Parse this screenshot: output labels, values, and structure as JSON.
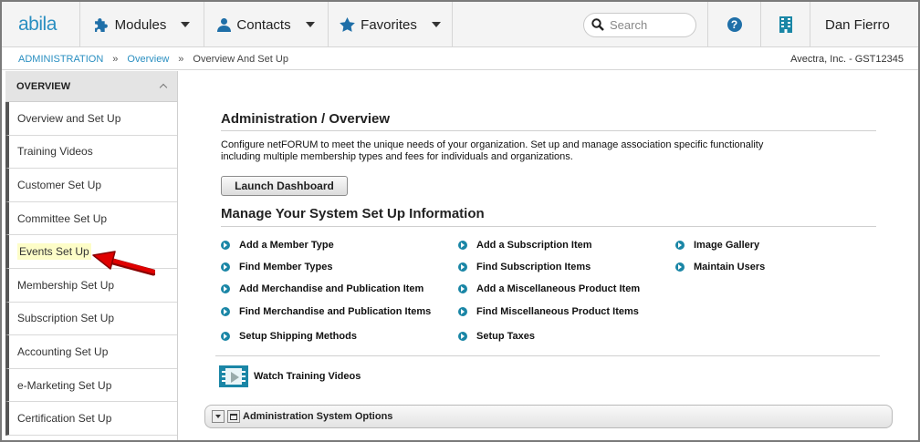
{
  "app": {
    "logo": "abila"
  },
  "topnav": {
    "modules": "Modules",
    "contacts": "Contacts",
    "favorites": "Favorites",
    "search_placeholder": "Search",
    "help_glyph": "?",
    "user": "Dan Fierro"
  },
  "breadcrumb": {
    "items": [
      "ADMINISTRATION",
      "Overview",
      "Overview And Set Up"
    ],
    "separator": "»",
    "organization": "Avectra, Inc. - GST12345"
  },
  "sidebar": {
    "header": "OVERVIEW",
    "items": [
      {
        "label": "Overview and Set Up"
      },
      {
        "label": "Training Videos"
      },
      {
        "label": "Customer Set Up"
      },
      {
        "label": "Committee Set Up"
      },
      {
        "label": "Events Set Up",
        "highlighted": true
      },
      {
        "label": "Membership Set Up"
      },
      {
        "label": "Subscription Set Up"
      },
      {
        "label": "Accounting Set Up"
      },
      {
        "label": "e-Marketing Set Up"
      },
      {
        "label": "Certification Set Up"
      }
    ]
  },
  "main": {
    "title": "Administration / Overview",
    "description": "Configure netFORUM to meet the unique needs of your organization. Set up and manage association specific functionality including multiple membership types and fees for individuals and organizations.",
    "launch_button": "Launch Dashboard",
    "manage_title": "Manage Your System Set Up Information",
    "links": {
      "add_member_type": "Add a Member Type",
      "find_member_types": "Find Member Types",
      "add_merch": "Add Merchandise and Publication Item",
      "find_merch": "Find Merchandise and Publication Items",
      "setup_shipping": "Setup Shipping Methods",
      "add_subscription": "Add a Subscription Item",
      "find_subscription": "Find Subscription Items",
      "add_misc": "Add a Miscellaneous Product Item",
      "find_misc": "Find Miscellaneous Product Items",
      "setup_taxes": "Setup Taxes",
      "image_gallery": "Image Gallery",
      "maintain_users": "Maintain Users"
    },
    "training_videos": "Watch Training Videos",
    "options_bar": "Administration System Options"
  },
  "colors": {
    "accent": "#2a8fc1",
    "link_dot": "#1a86a6",
    "highlight": "#fdfdc8",
    "arrow": "#e00000"
  }
}
